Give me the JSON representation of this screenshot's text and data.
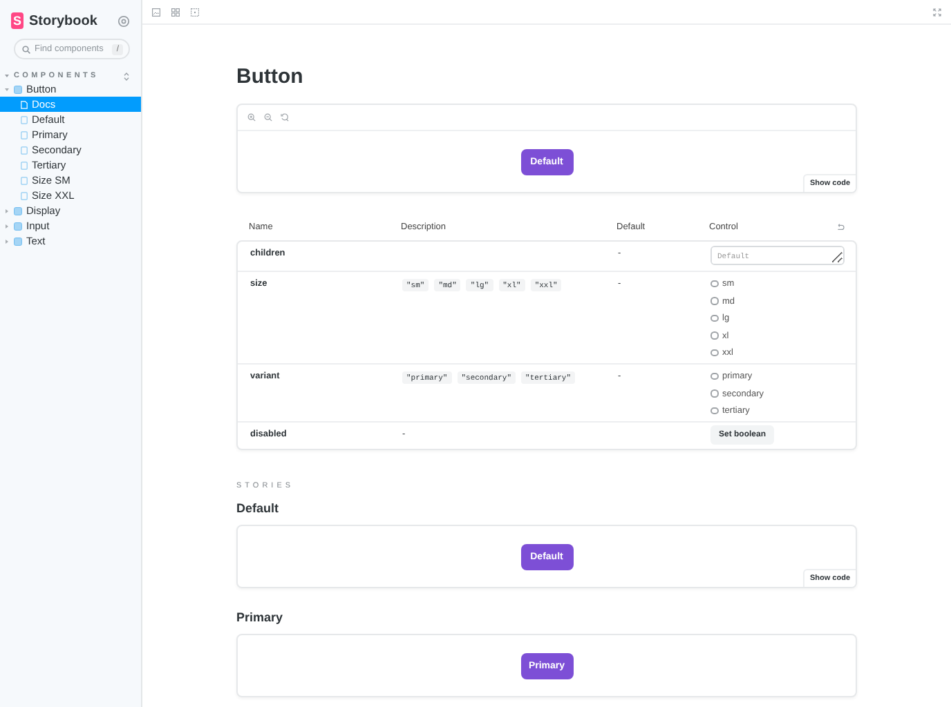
{
  "sidebar": {
    "logo_mark": "S",
    "brand": "Storybook",
    "search": {
      "placeholder": "Find components",
      "shortcut": "/"
    },
    "section": "COMPONENTS",
    "tree": [
      {
        "label": "Button",
        "kind": "component",
        "expanded": true,
        "selected": false,
        "children": [
          {
            "label": "Docs",
            "kind": "docs",
            "selected": true
          },
          {
            "label": "Default",
            "kind": "story",
            "selected": false
          },
          {
            "label": "Primary",
            "kind": "story",
            "selected": false
          },
          {
            "label": "Secondary",
            "kind": "story",
            "selected": false
          },
          {
            "label": "Tertiary",
            "kind": "story",
            "selected": false
          },
          {
            "label": "Size SM",
            "kind": "story",
            "selected": false
          },
          {
            "label": "Size XXL",
            "kind": "story",
            "selected": false
          }
        ]
      },
      {
        "label": "Display",
        "kind": "component",
        "expanded": false,
        "selected": false
      },
      {
        "label": "Input",
        "kind": "component",
        "expanded": false,
        "selected": false
      },
      {
        "label": "Text",
        "kind": "component",
        "expanded": false,
        "selected": false
      }
    ]
  },
  "docs": {
    "title": "Button",
    "preview": {
      "button": "Default",
      "show_code": "Show code"
    },
    "args_table": {
      "columns": [
        "Name",
        "Description",
        "Default",
        "Control"
      ],
      "rows": [
        {
          "name": "children",
          "default": "-",
          "control": {
            "kind": "text",
            "placeholder": "Default"
          }
        },
        {
          "name": "size",
          "description": {
            "kind": "values",
            "values": [
              "\"sm\"",
              "\"md\"",
              "\"lg\"",
              "\"xl\"",
              "\"xxl\""
            ]
          },
          "default": "-",
          "control": {
            "kind": "radio",
            "options": [
              {
                "label": "sm",
                "selected": false
              },
              {
                "label": "md",
                "selected": false
              },
              {
                "label": "lg",
                "selected": false
              },
              {
                "label": "xl",
                "selected": false
              },
              {
                "label": "xxl",
                "selected": false
              }
            ]
          }
        },
        {
          "name": "variant",
          "description": {
            "kind": "values",
            "values": [
              "\"primary\"",
              "\"secondary\"",
              "\"tertiary\""
            ]
          },
          "default": "-",
          "control": {
            "kind": "radio",
            "options": [
              {
                "label": "primary",
                "selected": false
              },
              {
                "label": "secondary",
                "selected": false
              },
              {
                "label": "tertiary",
                "selected": false
              }
            ]
          }
        },
        {
          "name": "disabled",
          "description": {
            "kind": "text",
            "text": "-"
          },
          "control": {
            "kind": "button",
            "label": "Set boolean"
          }
        }
      ]
    },
    "stories_heading": "STORIES",
    "stories": [
      {
        "title": "Default",
        "button": "Default",
        "show_code": "Show code"
      },
      {
        "title": "Primary",
        "button": "Primary"
      }
    ]
  }
}
